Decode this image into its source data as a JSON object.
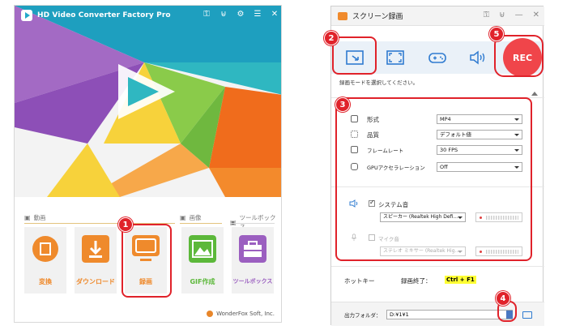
{
  "left_app": {
    "title": "HD Video Converter Factory Pro",
    "sections": {
      "video": "動画",
      "image": "画像",
      "toolbox": "ツールボックス"
    },
    "tiles": [
      {
        "label": "変換",
        "icon": "film-icon"
      },
      {
        "label": "ダウンロード",
        "icon": "download-icon"
      },
      {
        "label": "録画",
        "icon": "screen-record-icon"
      },
      {
        "label": "GIF作成",
        "icon": "image-icon"
      },
      {
        "label": "ツールボックス",
        "icon": "toolbox-icon"
      }
    ],
    "brand": "WonderFox Soft, Inc."
  },
  "right_app": {
    "title": "スクリーン録画",
    "rec_label": "REC",
    "mode_hint": "録画モードを選択してください。",
    "settings": {
      "format_label": "形式",
      "format_value": "MP4",
      "quality_label": "品質",
      "quality_value": "デフォルト値",
      "framerate_label": "フレームレート",
      "framerate_value": "30 FPS",
      "gpu_label": "GPUアクセラレーション",
      "gpu_value": "Off"
    },
    "audio": {
      "system_label": "システム音",
      "system_device": "スピーカー (Realtek High Defi...",
      "mic_label": "マイク音",
      "mic_device": "ステレオ ミキサー (Realtek Hig..."
    },
    "hotkey": {
      "label": "ホットキー",
      "end_label": "録画終了：",
      "end_key": "Ctrl + F1"
    },
    "output": {
      "label": "出力フォルダ：",
      "path": "D:¥1¥1"
    }
  },
  "annotations": [
    "1",
    "2",
    "3",
    "4",
    "5"
  ],
  "colors": {
    "accent_red": "#e0222a",
    "tile_orange": "#ef8a2c",
    "tile_green": "#5cb83a",
    "tile_purple": "#9b5fc0",
    "rec_red": "#f0454a"
  }
}
